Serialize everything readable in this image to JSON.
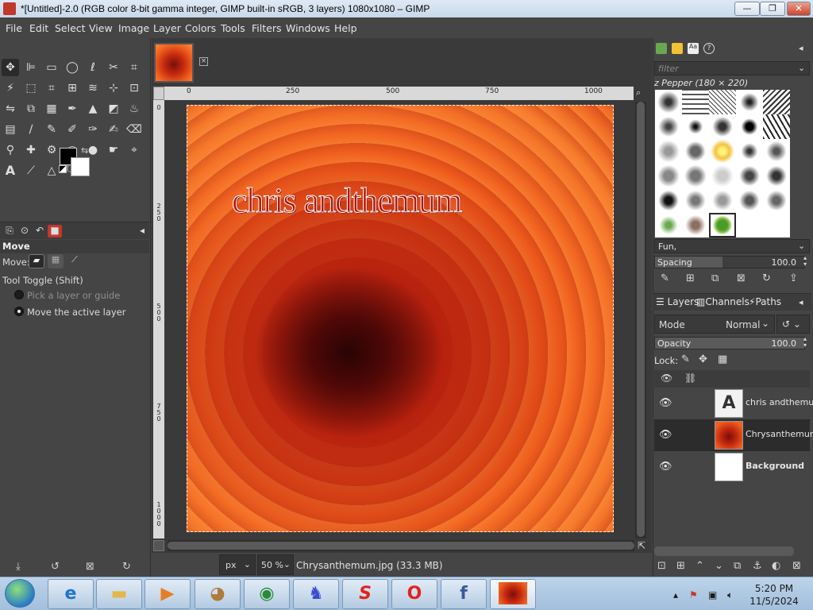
{
  "window": {
    "title": "*[Untitled]-2.0 (RGB color 8-bit gamma integer, GIMP built-in sRGB, 3 layers) 1080x1080 – GIMP",
    "minimize": "—",
    "maximize": "❐",
    "close": "✕"
  },
  "menu": [
    "File",
    "Edit",
    "Select",
    "View",
    "Image",
    "Layer",
    "Colors",
    "Tools",
    "Filters",
    "Windows",
    "Help"
  ],
  "tool_options": {
    "title": "Move",
    "move_label": "Move:",
    "toggle_label": "Tool Toggle  (Shift)",
    "option1": "Pick a layer or guide",
    "option2": "Move the active layer",
    "selected": "Move the active layer"
  },
  "ruler": {
    "h_ticks": [
      "0",
      "250",
      "500",
      "750",
      "1000"
    ],
    "v_ticks": [
      "0",
      "2 5 0",
      "5 0 0",
      "7 5 0",
      "1 0 0 0"
    ]
  },
  "canvas_text": "chris andthemum",
  "status": {
    "unit": "px",
    "zoom": "50 %",
    "text": "Chrysanthemum.jpg (33.3 MB)"
  },
  "brushes": {
    "filter_placeholder": "filter",
    "current": "z Pepper (180 × 220)",
    "tag": "Fun,",
    "spacing_label": "Spacing",
    "spacing_value": "100.0",
    "spacing_fraction": 0.45
  },
  "layers_panel": {
    "tabs": [
      "Layers",
      "Channels",
      "Paths"
    ],
    "mode_label": "Mode",
    "mode_value": "Normal",
    "opacity_label": "Opacity",
    "opacity_value": "100.0",
    "opacity_fraction": 1.0,
    "lock_label": "Lock:",
    "layers": [
      {
        "name": "chris andthemum",
        "kind": "text",
        "selected": false
      },
      {
        "name": "Chrysanthemum",
        "kind": "image",
        "selected": true
      },
      {
        "name": "Background",
        "kind": "white",
        "selected": false
      }
    ]
  },
  "taskbar": {
    "time": "5:20 PM",
    "date": "11/5/2024"
  },
  "colors": {
    "fg": "#000000",
    "bg": "#ffffff",
    "accent": "#c0392b"
  }
}
